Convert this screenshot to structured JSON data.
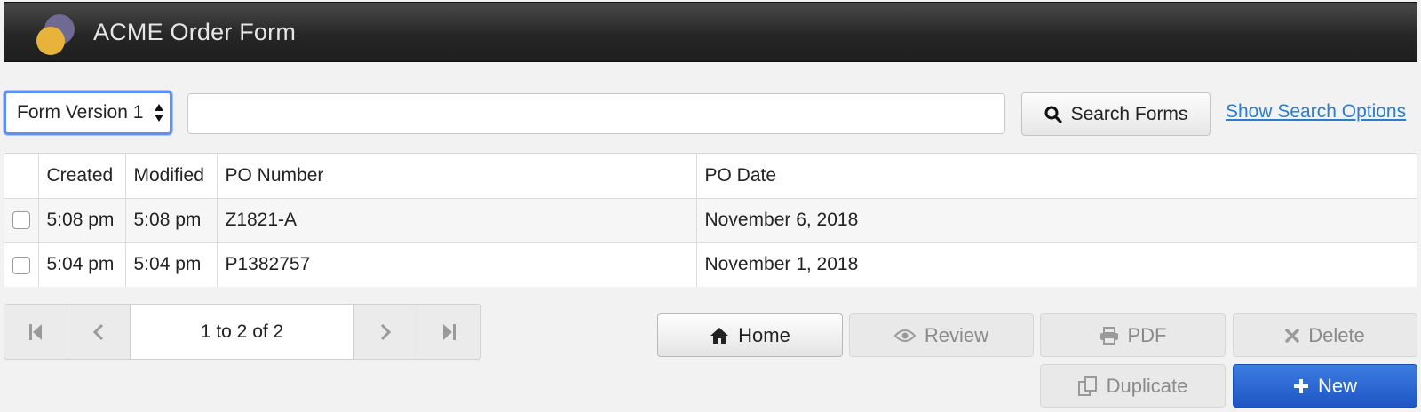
{
  "app": {
    "title": "ACME Order Form"
  },
  "toolbar": {
    "version_selected": "Form Version 1",
    "search_value": "",
    "search_button": "Search Forms",
    "search_options_link": "Show Search Options"
  },
  "table": {
    "columns": [
      "",
      "Created",
      "Modified",
      "PO Number",
      "PO Date"
    ],
    "rows": [
      {
        "checked": false,
        "created": "5:08 pm",
        "modified": "5:08 pm",
        "po_number": "Z1821-A",
        "po_date": "November 6, 2018"
      },
      {
        "checked": false,
        "created": "5:04 pm",
        "modified": "5:04 pm",
        "po_number": "P1382757",
        "po_date": "November 1, 2018"
      }
    ]
  },
  "pager": {
    "info": "1 to 2 of 2"
  },
  "actions": {
    "home": {
      "label": "Home",
      "icon": "home-icon",
      "enabled": true
    },
    "review": {
      "label": "Review",
      "icon": "eye-icon",
      "enabled": false
    },
    "pdf": {
      "label": "PDF",
      "icon": "printer-icon",
      "enabled": false
    },
    "delete": {
      "label": "Delete",
      "icon": "close-icon",
      "enabled": false
    },
    "duplicate": {
      "label": "Duplicate",
      "icon": "duplicate-icon",
      "enabled": false
    },
    "new": {
      "label": "New",
      "icon": "plus-icon",
      "enabled": true
    }
  },
  "colors": {
    "header_bg": "#262626",
    "link": "#2a7ccc",
    "primary_button": "#1e55c5",
    "focus_ring": "#5f8ff0",
    "logo_yellow": "#e8b33a",
    "logo_purple": "#6e6a94"
  }
}
